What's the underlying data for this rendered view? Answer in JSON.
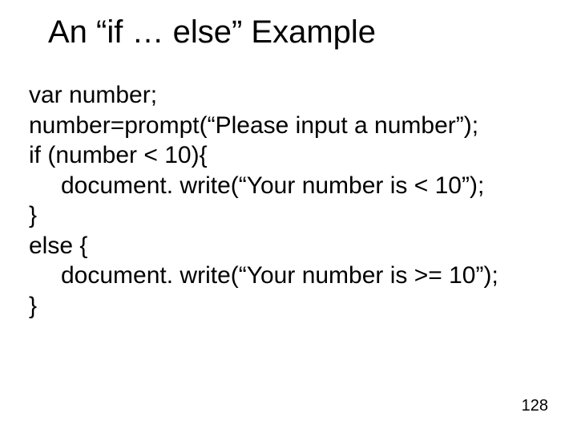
{
  "title": "An “if … else” Example",
  "code": {
    "l1": "var number;",
    "l2": "number=prompt(“Please input a number”);",
    "l3": "if (number < 10){",
    "l4": "document. write(“Your number is < 10”);",
    "l5": "}",
    "l6": "else {",
    "l7": "document. write(“Your number is >= 10”);",
    "l8": "}"
  },
  "page_number": "128"
}
